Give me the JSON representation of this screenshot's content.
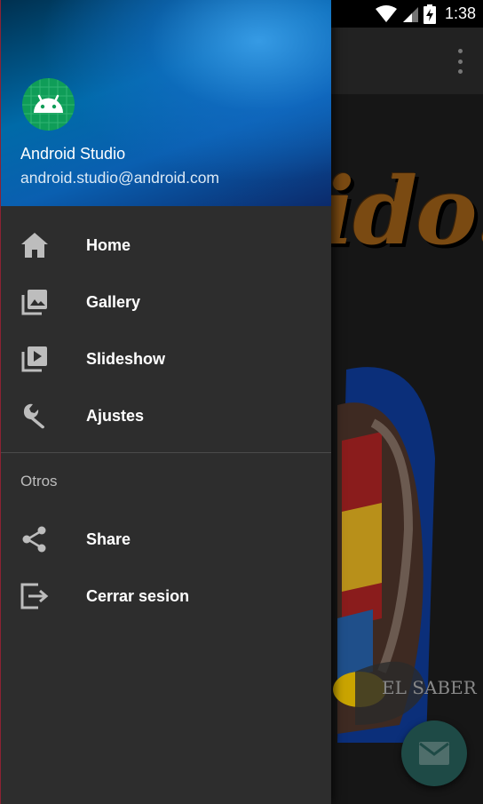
{
  "status_bar": {
    "time": "1:38",
    "icons": [
      "wifi-icon",
      "signal-icon",
      "battery-charging-icon"
    ]
  },
  "app_bar": {
    "overflow_icon": "more-vert-icon"
  },
  "background": {
    "title_fragment": "ido!",
    "crest_text": "EL SABER"
  },
  "drawer": {
    "header": {
      "avatar_icon": "android-icon",
      "user_name": "Android Studio",
      "user_email": "android.studio@android.com"
    },
    "main_items": [
      {
        "label": "Home",
        "icon": "home-icon"
      },
      {
        "label": "Gallery",
        "icon": "gallery-icon"
      },
      {
        "label": "Slideshow",
        "icon": "slideshow-icon"
      },
      {
        "label": "Ajustes",
        "icon": "wrench-icon"
      }
    ],
    "section_title": "Otros",
    "other_items": [
      {
        "label": "Share",
        "icon": "share-icon"
      },
      {
        "label": "Cerrar sesion",
        "icon": "exit-icon"
      }
    ]
  },
  "fab": {
    "icon": "mail-icon"
  },
  "colors": {
    "drawer_bg": "#2d2d2d",
    "header_blue": "#006aa8",
    "avatar_green": "#0f9d58",
    "fab_teal": "#1e4a46",
    "icon_gray": "#bdbdbd"
  }
}
